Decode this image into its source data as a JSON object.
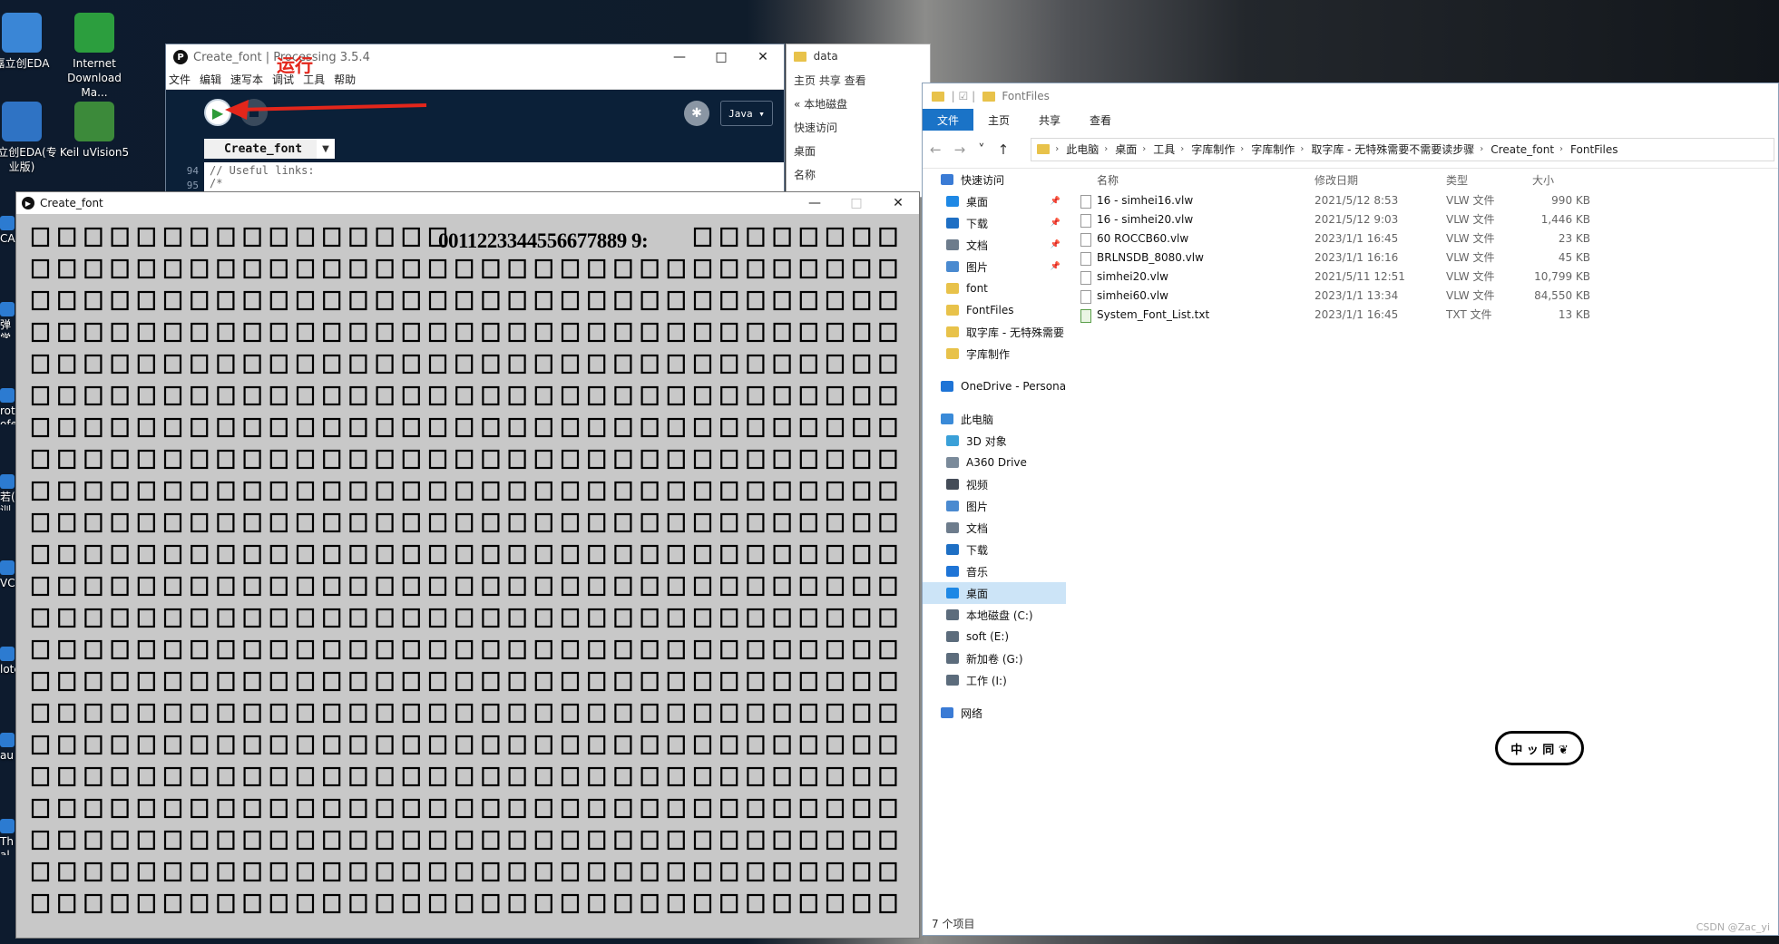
{
  "desktop": {
    "icons": [
      {
        "label": "嘉立创EDA",
        "color": "#3a86d6"
      },
      {
        "label": "Internet Download Ma...",
        "color": "#2c9e3e"
      },
      {
        "label": "嘉立创EDA(专业版)",
        "color": "#2f73c4"
      },
      {
        "label": "Keil uVision5",
        "color": "#3c8a3a"
      }
    ],
    "fragments": [
      "CA",
      "弹学",
      "rot ofe",
      "若( 训",
      "VCH",
      "lote",
      "au",
      "Th al T"
    ]
  },
  "processing": {
    "title": "Create_font | Processing 3.5.4",
    "logo": "P",
    "menu": [
      "文件",
      "编辑",
      "速写本",
      "调试",
      "工具",
      "帮助"
    ],
    "run_annotation": "运行",
    "mode": "Java ▾",
    "tab": "Create_font",
    "lines": [
      "94",
      "95"
    ],
    "code": [
      "// Useful links:",
      "/*"
    ]
  },
  "sketch": {
    "title": "Create_font",
    "glyphs": "0011223344556677889 9:"
  },
  "explorer_back": {
    "title": "data",
    "rows": [
      "主页   共享   查看",
      "« 本地磁盘",
      "快速访问",
      "桌面",
      "名称"
    ]
  },
  "explorer": {
    "title": "FontFiles",
    "ribbon": [
      "文件",
      "主页",
      "共享",
      "查看"
    ],
    "breadcrumb": [
      "此电脑",
      "桌面",
      "工具",
      "字库制作",
      "字库制作",
      "取字库 - 无特殊需要不需要读步骤",
      "Create_font",
      "FontFiles"
    ],
    "nav": [
      {
        "label": "快速访问",
        "icon": "star-icon",
        "color": "#3a7bd5",
        "pin": false,
        "sel": false,
        "indent": 0
      },
      {
        "label": "桌面",
        "icon": "desktop-icon",
        "color": "#1e88e5",
        "pin": true,
        "sel": false,
        "indent": 1
      },
      {
        "label": "下载",
        "icon": "download-icon",
        "color": "#1e6fc4",
        "pin": true,
        "sel": false,
        "indent": 1
      },
      {
        "label": "文档",
        "icon": "document-icon",
        "color": "#6d7c8c",
        "pin": true,
        "sel": false,
        "indent": 1
      },
      {
        "label": "图片",
        "icon": "picture-icon",
        "color": "#4a8ad0",
        "pin": true,
        "sel": false,
        "indent": 1
      },
      {
        "label": "font",
        "icon": "folder-icon",
        "color": "#e8c24a",
        "pin": false,
        "sel": false,
        "indent": 1
      },
      {
        "label": "FontFiles",
        "icon": "folder-icon",
        "color": "#e8c24a",
        "pin": false,
        "sel": false,
        "indent": 1
      },
      {
        "label": "取字库 - 无特殊需要",
        "icon": "folder-icon",
        "color": "#e8c24a",
        "pin": false,
        "sel": false,
        "indent": 1
      },
      {
        "label": "字库制作",
        "icon": "folder-icon",
        "color": "#e8c24a",
        "pin": false,
        "sel": false,
        "indent": 1
      },
      {
        "label": "",
        "icon": "",
        "color": "",
        "pin": false,
        "sel": false,
        "indent": 0
      },
      {
        "label": "OneDrive - Persona",
        "icon": "cloud-icon",
        "color": "#1e74d6",
        "pin": false,
        "sel": false,
        "indent": 0
      },
      {
        "label": "",
        "icon": "",
        "color": "",
        "pin": false,
        "sel": false,
        "indent": 0
      },
      {
        "label": "此电脑",
        "icon": "computer-icon",
        "color": "#3a8ad8",
        "pin": false,
        "sel": false,
        "indent": 0
      },
      {
        "label": "3D 对象",
        "icon": "cube-icon",
        "color": "#3aa0d8",
        "pin": false,
        "sel": false,
        "indent": 1
      },
      {
        "label": "A360 Drive",
        "icon": "drive-icon",
        "color": "#7a8a9a",
        "pin": false,
        "sel": false,
        "indent": 1
      },
      {
        "label": "视频",
        "icon": "video-icon",
        "color": "#444c58",
        "pin": false,
        "sel": false,
        "indent": 1
      },
      {
        "label": "图片",
        "icon": "picture-icon",
        "color": "#4a8ad0",
        "pin": false,
        "sel": false,
        "indent": 1
      },
      {
        "label": "文档",
        "icon": "document-icon",
        "color": "#6d7c8c",
        "pin": false,
        "sel": false,
        "indent": 1
      },
      {
        "label": "下载",
        "icon": "download-icon",
        "color": "#1e6fc4",
        "pin": false,
        "sel": false,
        "indent": 1
      },
      {
        "label": "音乐",
        "icon": "music-icon",
        "color": "#1e74d6",
        "pin": false,
        "sel": false,
        "indent": 1
      },
      {
        "label": "桌面",
        "icon": "desktop-icon",
        "color": "#1e88e5",
        "pin": false,
        "sel": true,
        "indent": 1
      },
      {
        "label": "本地磁盘 (C:)",
        "icon": "disk-icon",
        "color": "#5c6c7c",
        "pin": false,
        "sel": false,
        "indent": 1
      },
      {
        "label": "soft (E:)",
        "icon": "disk-icon",
        "color": "#5c6c7c",
        "pin": false,
        "sel": false,
        "indent": 1
      },
      {
        "label": "新加卷 (G:)",
        "icon": "disk-icon",
        "color": "#5c6c7c",
        "pin": false,
        "sel": false,
        "indent": 1
      },
      {
        "label": "工作 (I:)",
        "icon": "disk-icon",
        "color": "#5c6c7c",
        "pin": false,
        "sel": false,
        "indent": 1
      },
      {
        "label": "",
        "icon": "",
        "color": "",
        "pin": false,
        "sel": false,
        "indent": 0
      },
      {
        "label": "网络",
        "icon": "network-icon",
        "color": "#3a7bd5",
        "pin": false,
        "sel": false,
        "indent": 0
      }
    ],
    "columns": [
      "名称",
      "修改日期",
      "类型",
      "大小"
    ],
    "files": [
      {
        "name": "16 - simhei16.vlw",
        "date": "2021/5/12 8:53",
        "type": "VLW 文件",
        "size": "990 KB",
        "txt": false
      },
      {
        "name": "16 - simhei20.vlw",
        "date": "2021/5/12 9:03",
        "type": "VLW 文件",
        "size": "1,446 KB",
        "txt": false
      },
      {
        "name": "60 ROCCB60.vlw",
        "date": "2023/1/1 16:45",
        "type": "VLW 文件",
        "size": "23 KB",
        "txt": false
      },
      {
        "name": "BRLNSDB_8080.vlw",
        "date": "2023/1/1 16:16",
        "type": "VLW 文件",
        "size": "45 KB",
        "txt": false
      },
      {
        "name": "simhei20.vlw",
        "date": "2021/5/11 12:51",
        "type": "VLW 文件",
        "size": "10,799 KB",
        "txt": false
      },
      {
        "name": "simhei60.vlw",
        "date": "2023/1/1 13:34",
        "type": "VLW 文件",
        "size": "84,550 KB",
        "txt": false
      },
      {
        "name": "System_Font_List.txt",
        "date": "2023/1/1 16:45",
        "type": "TXT 文件",
        "size": "13 KB",
        "txt": true
      }
    ],
    "status": "7 个项目"
  },
  "signature": "中 ッ 同 ❦",
  "watermark": "CSDN @Zac_yi"
}
